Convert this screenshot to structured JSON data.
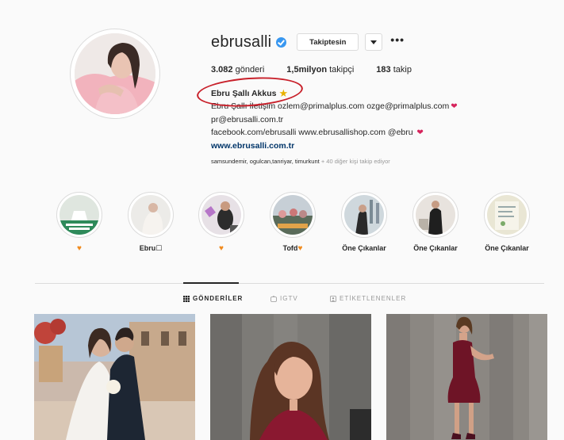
{
  "profile": {
    "username": "ebrusalli",
    "follow_label": "Takiptesin",
    "more_label": "•••",
    "stats": {
      "posts_value": "3.082",
      "posts_label": "gönderi",
      "followers_value": "1,5milyon",
      "followers_label": "takipçi",
      "following_value": "183",
      "following_label": "takip"
    },
    "bio": {
      "name": "Ebru Şallı Akkus",
      "line1": "Ebru Şallı İletişim ozlem@primalplus.com ozge@primalplus.com",
      "line2": "pr@ebrusalli.com.tr",
      "line3": "facebook.com/ebrusalli www.ebrusallishop.com @ebru",
      "link": "www.ebrusalli.com.tr"
    },
    "followed_by": "samsundemir, ogulcan,tanriyar, timurkunt",
    "followed_by_rest": "+ 40 diğer kişi takip ediyor"
  },
  "highlights": [
    {
      "label": ""
    },
    {
      "label": "Ebru☐"
    },
    {
      "label": ""
    },
    {
      "label": "Tofd"
    },
    {
      "label": "Öne Çıkanlar"
    },
    {
      "label": "Öne Çıkanlar"
    },
    {
      "label": "Öne Çıkanlar"
    }
  ],
  "tabs": {
    "posts": "GÖNDERİLER",
    "igtv": "IGTV",
    "tagged": "ETİKETLENENLER"
  },
  "colors": {
    "verified": "#3897f0",
    "annotation": "#c8202a",
    "link": "#003569",
    "heart_red": "#d6245c",
    "heart_orange": "#f08a1d"
  }
}
